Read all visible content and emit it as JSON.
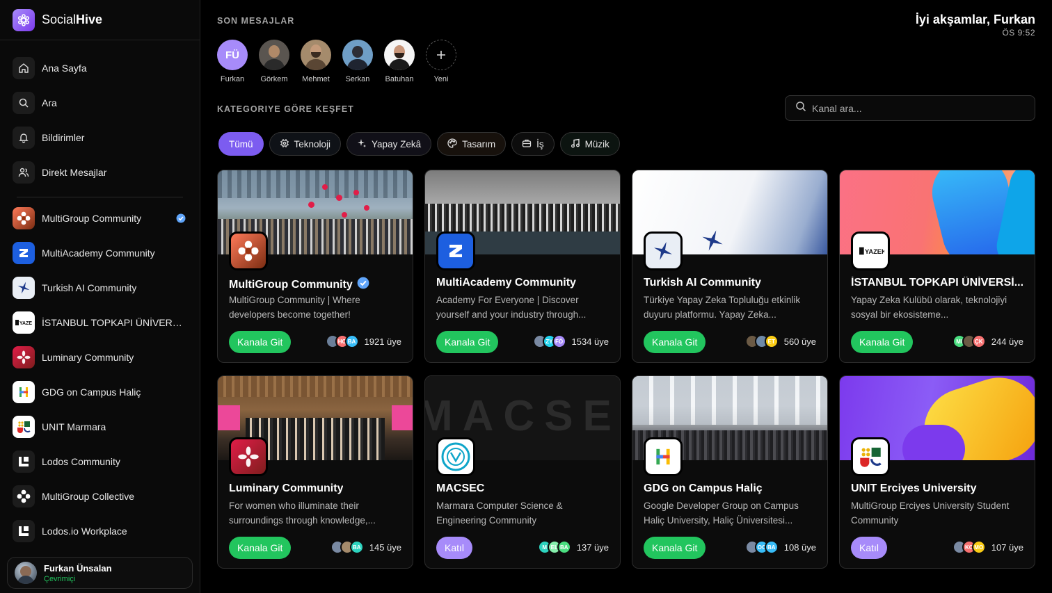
{
  "brand": {
    "name_a": "Social",
    "name_b": "Hive"
  },
  "nav": [
    {
      "label": "Ana Sayfa",
      "icon": "home-icon"
    },
    {
      "label": "Ara",
      "icon": "search-icon"
    },
    {
      "label": "Bildirimler",
      "icon": "bell-icon"
    },
    {
      "label": "Direkt Mesajlar",
      "icon": "users-icon"
    }
  ],
  "sidebar_communities": [
    {
      "label": "MultiGroup Community",
      "verified": true
    },
    {
      "label": "MultiAcademy Community"
    },
    {
      "label": "Turkish AI Community"
    },
    {
      "label": "İSTANBUL TOPKAPI ÜNİVERSİ..."
    },
    {
      "label": "Luminary Community"
    },
    {
      "label": "GDG on Campus Haliç"
    },
    {
      "label": "UNIT Marmara"
    },
    {
      "label": "Lodos Community"
    },
    {
      "label": "MultiGroup Collective"
    },
    {
      "label": "Lodos.io Workplace"
    }
  ],
  "profile": {
    "name": "Furkan Ünsalan",
    "status": "Çevrimiçi"
  },
  "header": {
    "recent_title": "SON MESAJLAR",
    "greeting": "İyi akşamlar, Furkan",
    "time": "ÖS 9:52",
    "explore_title": "KATEGORIYE GÖRE KEŞFET"
  },
  "stories": [
    {
      "name": "Furkan",
      "initials": "FÜ"
    },
    {
      "name": "Görkem"
    },
    {
      "name": "Mehmet"
    },
    {
      "name": "Serkan"
    },
    {
      "name": "Batuhan"
    },
    {
      "name": "Yeni"
    }
  ],
  "search": {
    "placeholder": "Kanal ara..."
  },
  "filters": [
    {
      "label": "Tümü",
      "active": true
    },
    {
      "label": "Teknoloji",
      "icon": "chip-cpu-icon"
    },
    {
      "label": "Yapay Zekâ",
      "icon": "sparkle-icon"
    },
    {
      "label": "Tasarım",
      "icon": "palette-icon"
    },
    {
      "label": "İş",
      "icon": "briefcase-icon"
    },
    {
      "label": "Müzik",
      "icon": "music-note-icon"
    }
  ],
  "cards": [
    {
      "title": "MultiGroup Community",
      "verified": true,
      "desc": "MultiGroup Community | Where developers become together!",
      "button": "Kanala Git",
      "members": "1921 üye",
      "avatars": [
        "",
        "HC",
        "BA"
      ]
    },
    {
      "title": "MultiAcademy Community",
      "desc": "Academy For Everyone | Discover yourself and your industry through...",
      "button": "Kanala Git",
      "members": "1534 üye",
      "avatars": [
        "",
        "ZY",
        "FÖ"
      ]
    },
    {
      "title": "Turkish AI Community",
      "desc": "Türkiye Yapay Zeka Topluluğu etkinlik duyuru platformu. Yapay Zeka...",
      "button": "Kanala Git",
      "members": "560 üye",
      "avatars": [
        "",
        "",
        "ET"
      ]
    },
    {
      "title": "İSTANBUL TOPKAPI ÜNİVERSİ...",
      "desc": "Yapay Zeka Kulübü olarak, teknolojiyi sosyal bir ekosisteme...",
      "button": "Kanala Git",
      "members": "244 üye",
      "avatars": [
        "MI",
        "",
        "ÇK"
      ]
    },
    {
      "title": "Luminary Community",
      "desc": "For women who illuminate their surroundings through knowledge,...",
      "button": "Kanala Git",
      "members": "145 üye",
      "avatars": [
        "",
        "",
        "BA"
      ]
    },
    {
      "title": "MACSEC",
      "desc": "Marmara Computer Science & Engineering Community",
      "button": "Katıl",
      "members": "137 üye",
      "avatars": [
        "M",
        "EL",
        "BA"
      ],
      "cover_text": "MACSEC"
    },
    {
      "title": "GDG on Campus Haliç",
      "desc": "Google Developer Group on Campus Haliç University, Haliç Üniversitesi...",
      "button": "Kanala Git",
      "members": "108 üye",
      "avatars": [
        "",
        "OC",
        "BA"
      ]
    },
    {
      "title": "UNIT Erciyes University",
      "desc": "MultiGroup Erciyes University Student Community",
      "button": "Katıl",
      "members": "107 üye",
      "avatars": [
        "",
        "KC",
        "MO"
      ]
    }
  ],
  "colors": {
    "accent": "#7c5cf0",
    "go": "#22c55e",
    "join": "#a78bfa",
    "verified": "#60a5fa"
  }
}
